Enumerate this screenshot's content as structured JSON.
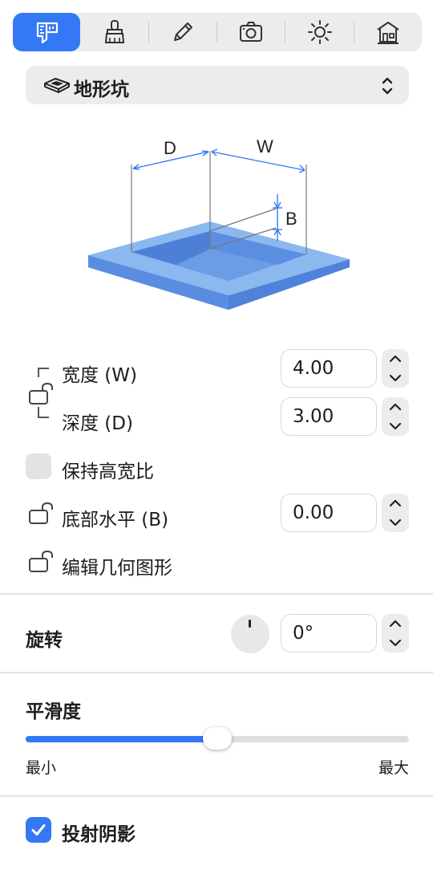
{
  "toolbar": {
    "tabs": [
      {
        "icon": "measure-icon",
        "active": true
      },
      {
        "icon": "brush-icon",
        "active": false
      },
      {
        "icon": "pencil-icon",
        "active": false
      },
      {
        "icon": "camera-icon",
        "active": false
      },
      {
        "icon": "sun-icon",
        "active": false
      },
      {
        "icon": "house-icon",
        "active": false
      }
    ]
  },
  "type_select": {
    "label": "地形坑",
    "icon": "terrain-pit-icon"
  },
  "diagram": {
    "label_d": "D",
    "label_w": "W",
    "label_b": "B"
  },
  "dimensions": {
    "width": {
      "label": "宽度 (W)",
      "value": "4.00"
    },
    "depth": {
      "label": "深度 (D)",
      "value": "3.00"
    },
    "keep_ratio_label": "保持高宽比",
    "bottom": {
      "label": "底部水平 (B)",
      "value": "0.00"
    },
    "edit_geometry_label": "编辑几何图形"
  },
  "rotation": {
    "title": "旋转",
    "value": "0°"
  },
  "smoothness": {
    "title": "平滑度",
    "min_label": "最小",
    "max_label": "最大",
    "level": 0.5
  },
  "shadow": {
    "label": "投射阴影",
    "checked": true
  },
  "colors": {
    "accent": "#3478f6",
    "pit_top": "#8ab8ef",
    "pit_side": "#4f82d9",
    "pit_inner": "#5b8ee0"
  }
}
